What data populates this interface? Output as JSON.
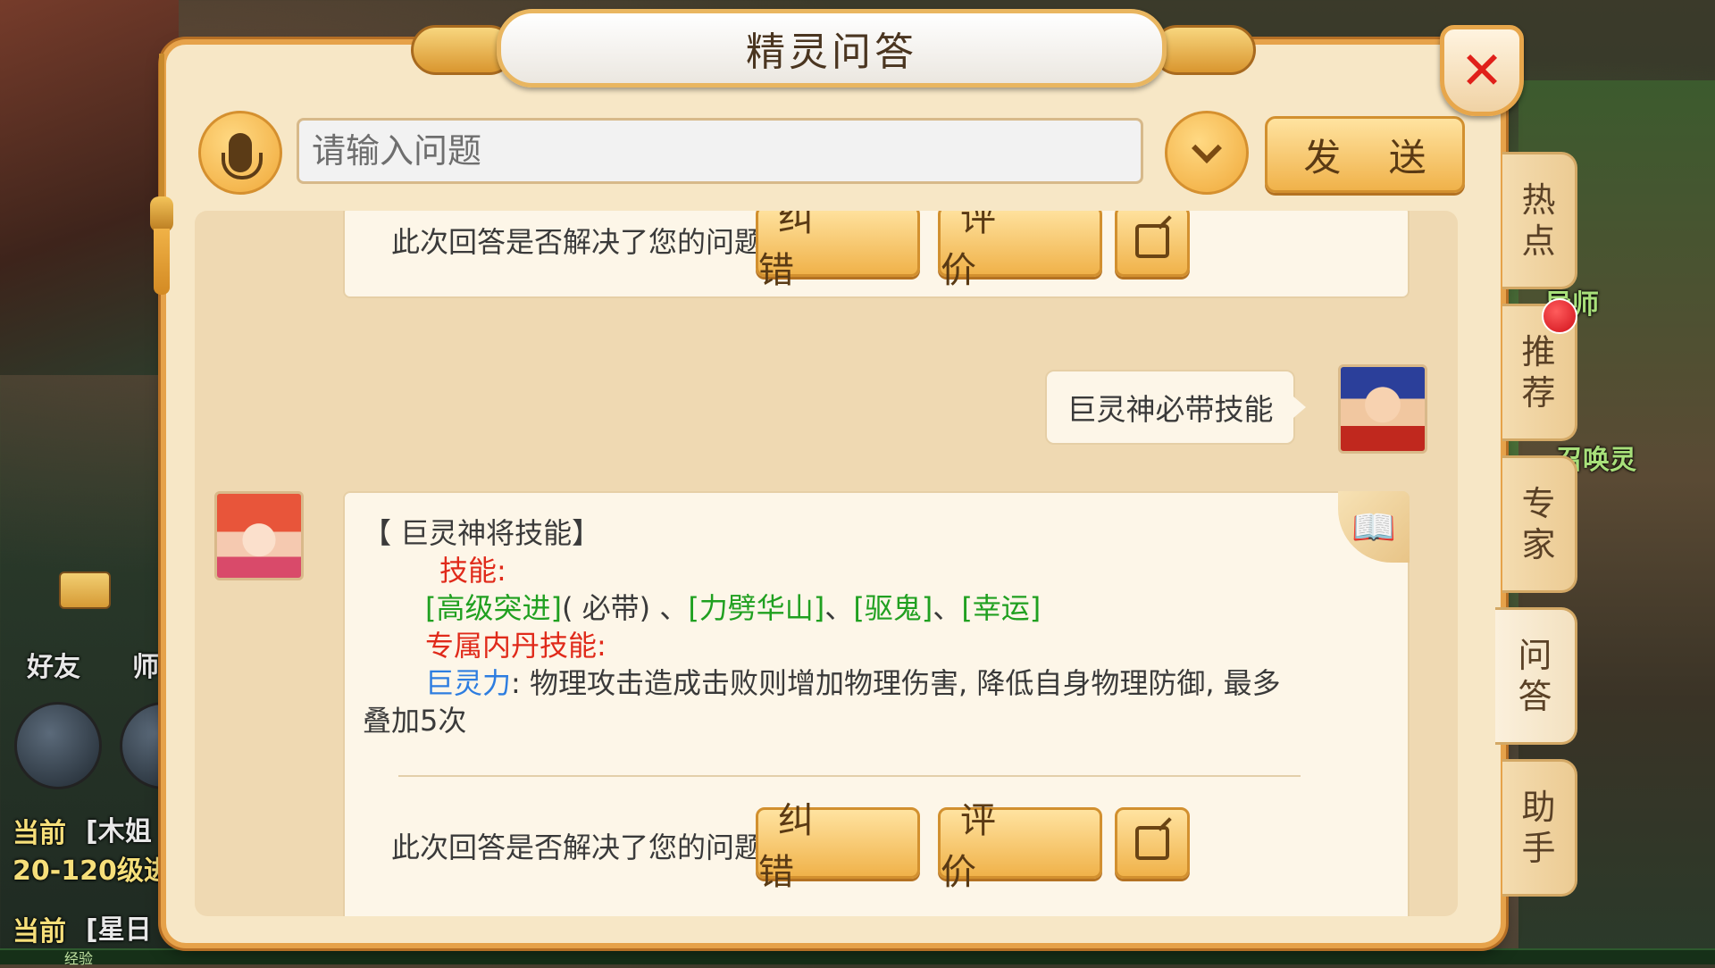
{
  "dialog": {
    "title": "精灵问答",
    "input_placeholder": "请输入问题",
    "send_label": "发 送"
  },
  "side_tabs": [
    "热点",
    "推荐",
    "专家",
    "问答",
    "助手"
  ],
  "chat": {
    "feedback_question": "此次回答是否解决了您的问题?",
    "correct_label": "纠 错",
    "rate_label": "评 价",
    "user_message": "巨灵神必带技能",
    "answer": {
      "heading": "【 巨灵神将技能】",
      "skills_label": "技能:",
      "skill_1": "[高级突进]",
      "skill_1_note": "( 必带) 、",
      "skill_2": "[力劈华山]",
      "sep": "、",
      "skill_3": "[驱鬼]",
      "skill_4": "[幸运]",
      "neidan_label": "专属内丹技能:",
      "neidan_name": "巨灵力",
      "neidan_desc": ": 物理攻击造成击败则增加物理伤害, 降低自身物理防御, 最多",
      "neidan_desc_2": "叠加5次"
    }
  },
  "background": {
    "friends_label": "好友",
    "master_label": "师",
    "current_1": "当前",
    "quest_1_name": "[木姐",
    "quest_1_detail": "20-120级进",
    "current_2": "当前",
    "quest_2_name": "[星日",
    "exp_label": "经验",
    "npc_1": "导师",
    "npc_2": "召唤灵"
  },
  "colors": {
    "accent_gold": "#f0b24a",
    "close_red": "#e0201a",
    "skill_green": "#20a020",
    "label_red": "#e02a1a",
    "neidan_blue": "#2d7de0"
  },
  "icons": [
    "microphone-icon",
    "chevron-down-icon",
    "close-icon",
    "share-icon",
    "book-icon",
    "mail-icon"
  ]
}
